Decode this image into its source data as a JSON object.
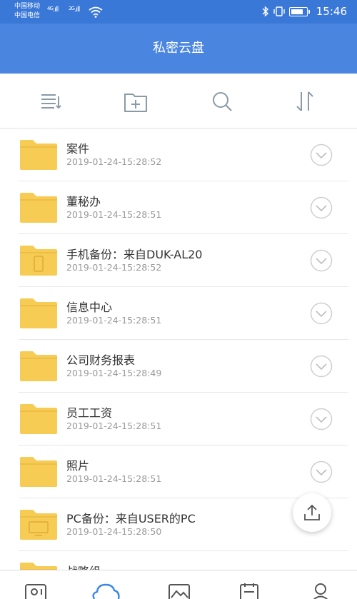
{
  "status_bar": {
    "carrier1": "中国移动",
    "carrier2": "中国电信",
    "net1": "4G",
    "net2": "2G",
    "time": "15:46"
  },
  "header": {
    "title": "私密云盘"
  },
  "toolbar": {
    "icons": [
      "list-sort-icon",
      "new-folder-icon",
      "search-icon",
      "sort-order-icon"
    ]
  },
  "files": [
    {
      "name": "案件",
      "date": "2019-01-24-15:28:52",
      "icon": "folder-icon"
    },
    {
      "name": "董秘办",
      "date": "2019-01-24-15:28:51",
      "icon": "folder-icon"
    },
    {
      "name": "手机备份：来自DUK-AL20",
      "date": "2019-01-24-15:28:52",
      "icon": "phone-folder-icon"
    },
    {
      "name": "信息中心",
      "date": "2019-01-24-15:28:51",
      "icon": "folder-icon"
    },
    {
      "name": "公司财务报表",
      "date": "2019-01-24-15:28:49",
      "icon": "folder-icon"
    },
    {
      "name": "员工工资",
      "date": "2019-01-24-15:28:51",
      "icon": "folder-icon"
    },
    {
      "name": "照片",
      "date": "2019-01-24-15:28:51",
      "icon": "folder-icon"
    },
    {
      "name": "PC备份：来自USER的PC",
      "date": "2019-01-24-15:28:50",
      "icon": "pc-folder-icon"
    },
    {
      "name": "战略组",
      "date": "",
      "icon": "folder-icon"
    }
  ],
  "colors": {
    "header_blue": "#4a86e0",
    "status_blue": "#3a78d8",
    "folder_yellow": "#f6cc55",
    "active_nav": "#3a86e8",
    "icon_gray": "#8a9aa6"
  }
}
